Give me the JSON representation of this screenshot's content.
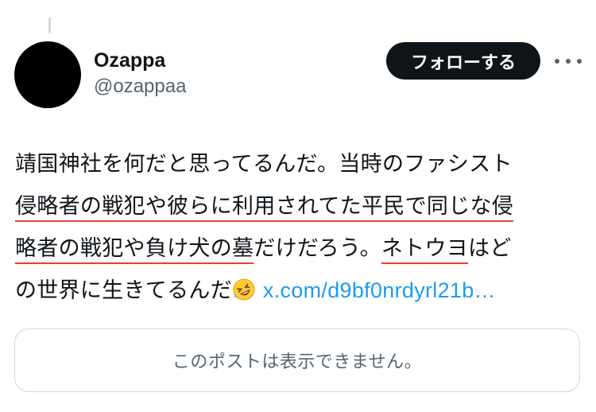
{
  "author": {
    "display_name": "Ozappa",
    "handle": "@ozappaa"
  },
  "actions": {
    "follow_label": "フォローする",
    "more_icon": "more-horizontal-icon"
  },
  "tweet": {
    "line1": "靖国神社を何だと思ってるんだ。当時のファシスト",
    "line2_a": "侵略者の戦犯や彼らに利用されてた平民で同じな侵",
    "line3_a": "略者の戦犯や負け犬の墓",
    "line3_b": "だけだろう。",
    "line3_c": "ネトウヨ",
    "line3_d": "はど",
    "line4_text": "の世界に生きてるんだ",
    "emoji": "rolling-on-the-floor-laughing-emoji",
    "link_text": "x.com/d9bf0nrdyrl21b…"
  },
  "quoted_post": {
    "unavailable_text": "このポストは表示できません。"
  },
  "colors": {
    "follow_bg": "#0f1419",
    "link": "#1d9bf0",
    "underline_annotation": "#e0442c",
    "secondary_text": "#536471"
  }
}
